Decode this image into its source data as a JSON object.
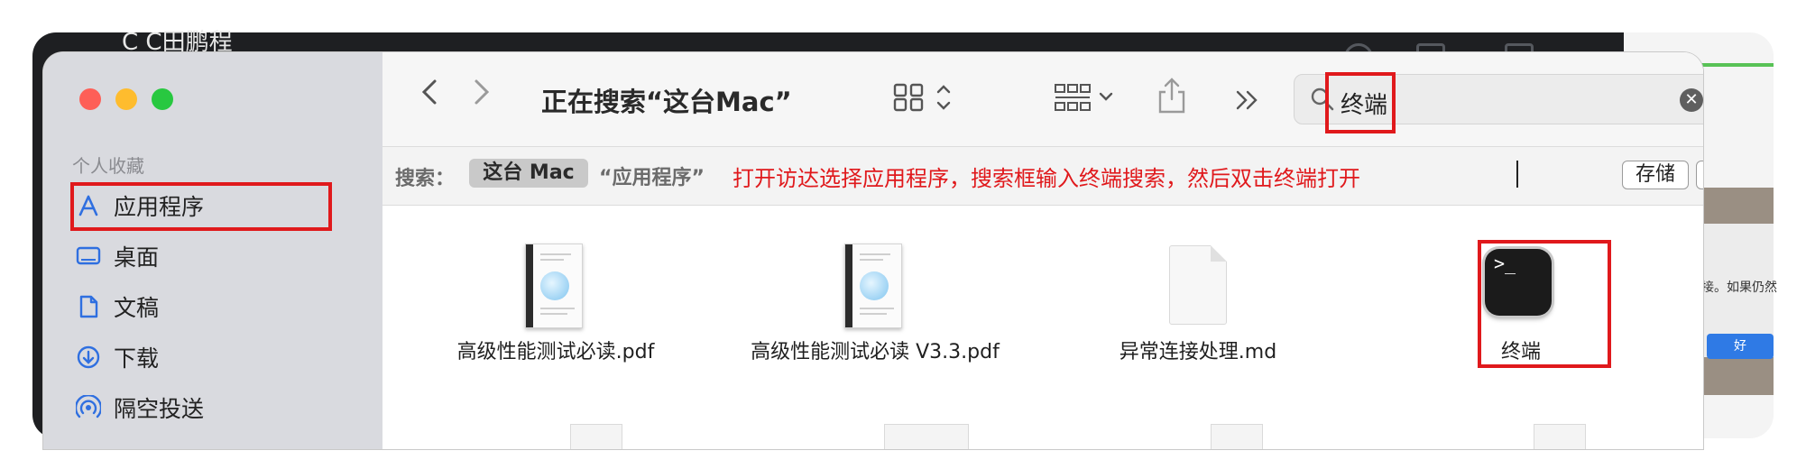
{
  "background": {
    "window_title": "C C田鹏程",
    "dialog_text": "接。如果仍然",
    "dialog_button": "好"
  },
  "finder": {
    "sidebar": {
      "section_header": "个人收藏",
      "items": [
        {
          "label": "应用程序",
          "icon": "applications-icon"
        },
        {
          "label": "桌面",
          "icon": "desktop-icon"
        },
        {
          "label": "文稿",
          "icon": "documents-icon"
        },
        {
          "label": "下载",
          "icon": "downloads-icon"
        },
        {
          "label": "隔空投送",
          "icon": "airdrop-icon"
        }
      ]
    },
    "toolbar": {
      "title": "正在搜索“这台Mac”",
      "search_value": "终端"
    },
    "scope_bar": {
      "label": "搜索：",
      "scope_this_mac": "这台 Mac",
      "scope_applications": "“应用程序”",
      "annotation": "打开访达选择应用程序，搜索框输入终端搜索，然后双击终端打开",
      "save_label": "存储",
      "add_label": "+"
    },
    "files": [
      {
        "name": "高级性能测试必读.pdf",
        "icon": "pdf-document-icon"
      },
      {
        "name": "高级性能测试必读 V3.3.pdf",
        "icon": "pdf-document-icon"
      },
      {
        "name": "异常连接处理.md",
        "icon": "markdown-document-icon"
      },
      {
        "name": "终端",
        "icon": "terminal-app-icon"
      }
    ]
  },
  "colors": {
    "highlight_red": "#e0191c",
    "accent_blue": "#2f6fe0"
  }
}
